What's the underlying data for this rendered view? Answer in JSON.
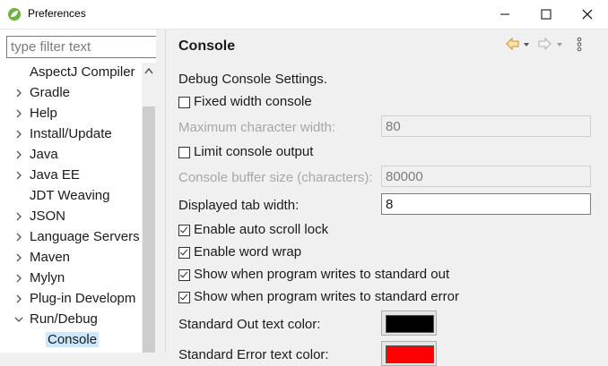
{
  "window": {
    "title": "Preferences"
  },
  "filter": {
    "placeholder": "type filter text",
    "value": ""
  },
  "tree": {
    "items": [
      {
        "label": "AspectJ Compiler",
        "expandable": false
      },
      {
        "label": "Gradle",
        "expandable": true
      },
      {
        "label": "Help",
        "expandable": true
      },
      {
        "label": "Install/Update",
        "expandable": true
      },
      {
        "label": "Java",
        "expandable": true
      },
      {
        "label": "Java EE",
        "expandable": true
      },
      {
        "label": "JDT Weaving",
        "expandable": false
      },
      {
        "label": "JSON",
        "expandable": true
      },
      {
        "label": "Language Servers",
        "expandable": true
      },
      {
        "label": "Maven",
        "expandable": true
      },
      {
        "label": "Mylyn",
        "expandable": true
      },
      {
        "label": "Plug-in Developm",
        "expandable": true
      },
      {
        "label": "Run/Debug",
        "expandable": true,
        "expanded": true
      },
      {
        "label": "Console",
        "expandable": false,
        "selected": true,
        "child": true
      }
    ]
  },
  "page": {
    "title": "Console",
    "section_label": "Debug Console Settings.",
    "fixed_width": {
      "label": "Fixed width console",
      "checked": false
    },
    "max_char_width": {
      "label": "Maximum character width:",
      "value": "80",
      "enabled": false
    },
    "limit_output": {
      "label": "Limit console output",
      "checked": false
    },
    "buffer_size": {
      "label": "Console buffer size (characters):",
      "value": "80000",
      "enabled": false
    },
    "tab_width": {
      "label": "Displayed tab width:",
      "value": "8",
      "enabled": true
    },
    "auto_scroll": {
      "label": "Enable auto scroll lock",
      "checked": true
    },
    "word_wrap": {
      "label": "Enable word wrap",
      "checked": true
    },
    "show_stdout": {
      "label": "Show when program writes to standard out",
      "checked": true
    },
    "show_stderr": {
      "label": "Show when program writes to standard error",
      "checked": true
    },
    "stdout_color": {
      "label": "Standard Out text color:",
      "color": "#000000"
    },
    "stderr_color": {
      "label": "Standard Error text color:",
      "color": "#ff0000"
    }
  },
  "icons": {
    "back": "arrow-left-icon",
    "forward": "arrow-right-icon",
    "menu": "vertical-ellipsis-icon"
  },
  "colors": {
    "accent_orange": "#e8a640",
    "selection": "#cce8ff"
  }
}
